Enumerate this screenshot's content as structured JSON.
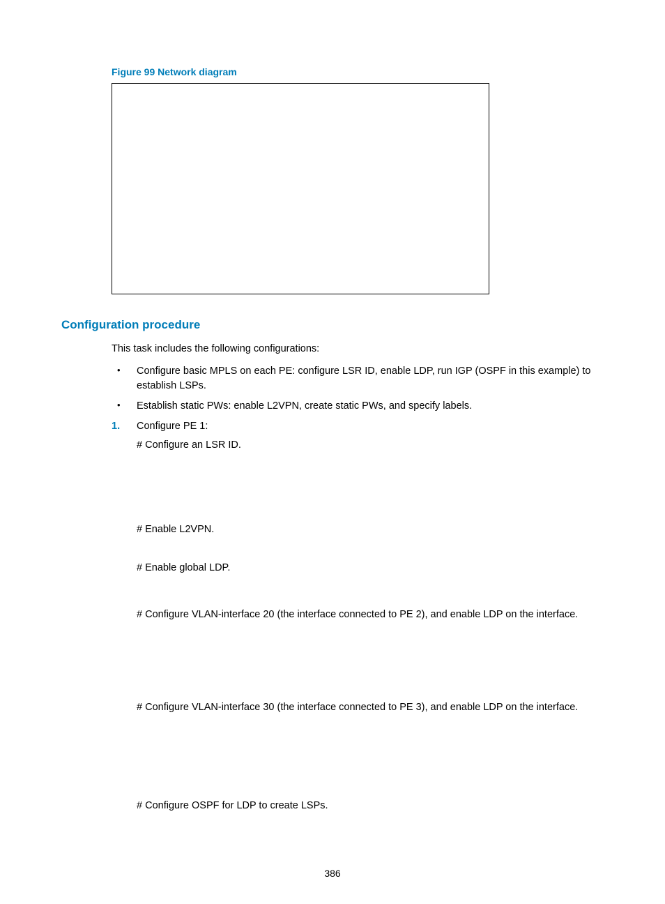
{
  "figure_caption": "Figure 99 Network diagram",
  "section_heading": "Configuration procedure",
  "intro": "This task includes the following configurations:",
  "bullets": [
    "Configure basic MPLS on each PE: configure LSR ID, enable LDP, run IGP (OSPF in this example) to establish LSPs.",
    "Establish static PWs: enable L2VPN, create static PWs, and specify labels."
  ],
  "step": {
    "marker": "1.",
    "title": "Configure PE 1:",
    "subs": [
      "# Configure an LSR ID.",
      "# Enable L2VPN.",
      "# Enable global LDP.",
      "# Configure VLAN-interface 20 (the interface connected to PE 2), and enable LDP on the interface.",
      "# Configure VLAN-interface 30 (the interface connected to PE 3), and enable LDP on the interface.",
      "# Configure OSPF for LDP to create LSPs."
    ]
  },
  "page_number": "386"
}
